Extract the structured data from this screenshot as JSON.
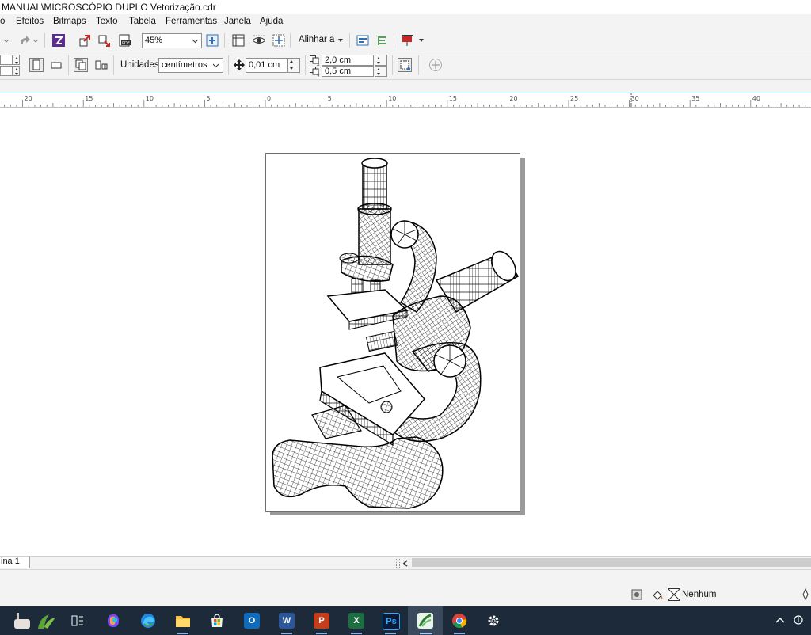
{
  "window": {
    "title": "MANUAL\\MICROSCÓPIO DUPLO Vetorização.cdr"
  },
  "menu": [
    {
      "label": "o"
    },
    {
      "label": "Efeitos"
    },
    {
      "label": "Bitmaps"
    },
    {
      "label": "Texto"
    },
    {
      "label": "Tabela"
    },
    {
      "label": "Ferramentas"
    },
    {
      "label": "Janela"
    },
    {
      "label": "Ajuda"
    }
  ],
  "toolbar": {
    "zoom_value": "45%",
    "align_label": "Alinhar a",
    "units_label": "Unidades:",
    "units_value": "centímetros",
    "nudge_value": "0,01 cm",
    "dup_x_value": "2,0 cm",
    "dup_y_value": "0,5 cm"
  },
  "ruler": {
    "labels": [
      "20",
      "15",
      "10",
      "5",
      "0",
      "5",
      "10",
      "15",
      "20",
      "25",
      "30",
      "35",
      "40"
    ]
  },
  "page_tabs": {
    "current": "ina 1"
  },
  "status": {
    "fill_label": "Nenhum"
  },
  "taskbar": {
    "apps": [
      "task-view",
      "copilot",
      "edge",
      "file-explorer",
      "microsoft-store",
      "outlook",
      "word",
      "powerpoint",
      "excel",
      "photoshop",
      "coreldraw",
      "chrome",
      "settings"
    ],
    "word_glyph": "W",
    "powerpoint_glyph": "P",
    "excel_glyph": "X",
    "photoshop_glyph": "Ps",
    "outlook_glyph": "O"
  }
}
